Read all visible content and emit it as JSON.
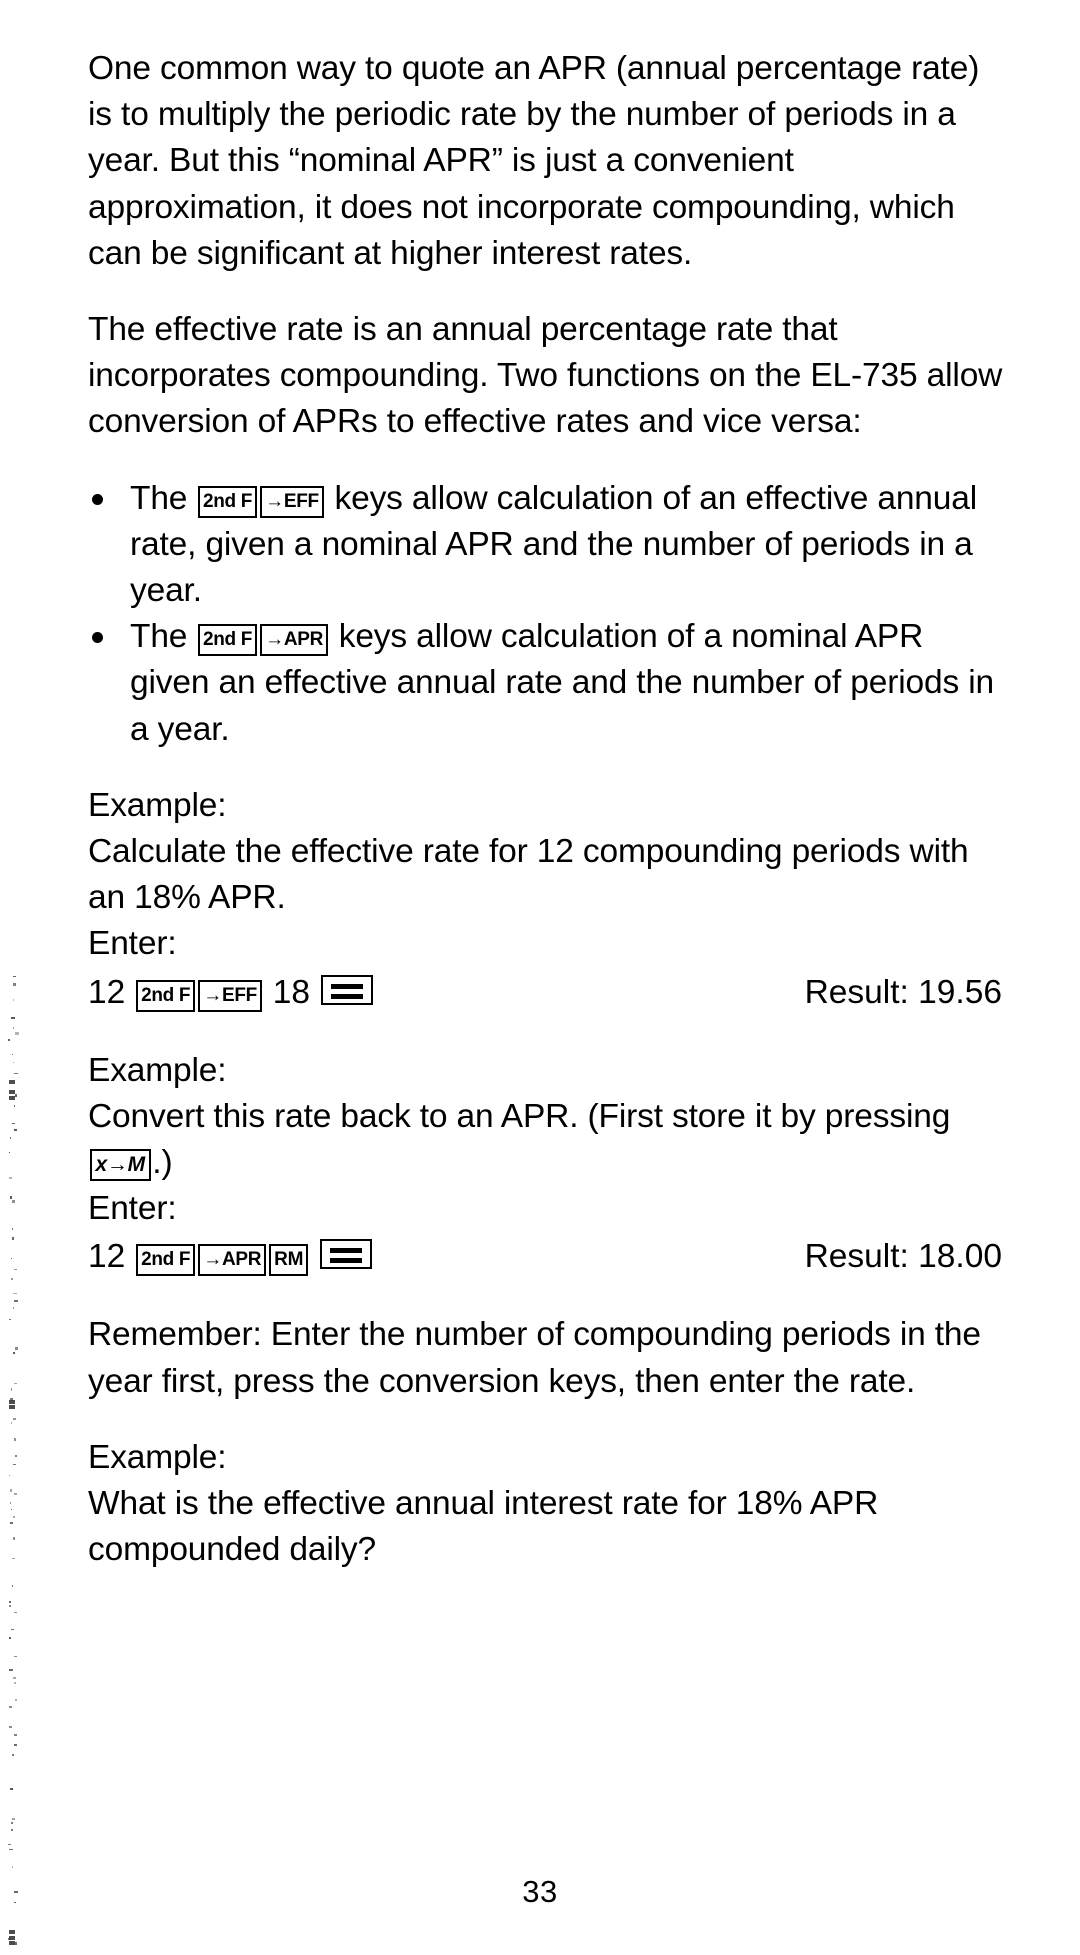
{
  "document": {
    "page_number": "33",
    "paragraphs": {
      "p1": "One common way to quote an APR (annual percentage rate) is to multiply the periodic rate by the number of periods in a year. But this “nominal APR” is just a convenient approximation, it does not incorporate compounding, which can be significant at higher interest rates.",
      "p2": "The effective rate is an annual percentage rate that incorporates compounding. Two functions on the EL-735 allow conversion of APRs to effective rates and vice versa:",
      "remember": "Remember: Enter the number of compounding periods in the year first, press the conversion keys, then enter the rate."
    },
    "bullets": [
      {
        "lead": "The",
        "keys": [
          "2nd F",
          "→EFF"
        ],
        "trail": "keys allow calculation of an effective annual rate, given a nominal APR and the number of periods in a year."
      },
      {
        "lead": "The",
        "keys": [
          "2nd F",
          "→APR"
        ],
        "trail": "keys allow calculation of a nominal APR given an effective annual rate and the number of periods in a year."
      }
    ],
    "examples": [
      {
        "heading": "Example:",
        "prompt": "Calculate the effective rate for 12 compounding periods with an 18% APR.",
        "enter_label": "Enter:",
        "entry_prefix": "12",
        "entry_keys": [
          "2nd F",
          "→EFF"
        ],
        "entry_middle": "18",
        "entry_equals": "=",
        "result": "Result: 19.56"
      },
      {
        "heading": "Example:",
        "prompt": "Convert this rate back to an APR. (First store it by pressing",
        "prompt_key": "x→M",
        "prompt_tail": ".)",
        "enter_label": "Enter:",
        "entry_prefix": "12",
        "entry_keys": [
          "2nd F",
          "→APR",
          "RM"
        ],
        "entry_equals": "=",
        "result": "Result: 18.00"
      },
      {
        "heading": "Example:",
        "prompt": "What is the effective annual interest rate for 18% APR compounded daily?"
      }
    ]
  }
}
